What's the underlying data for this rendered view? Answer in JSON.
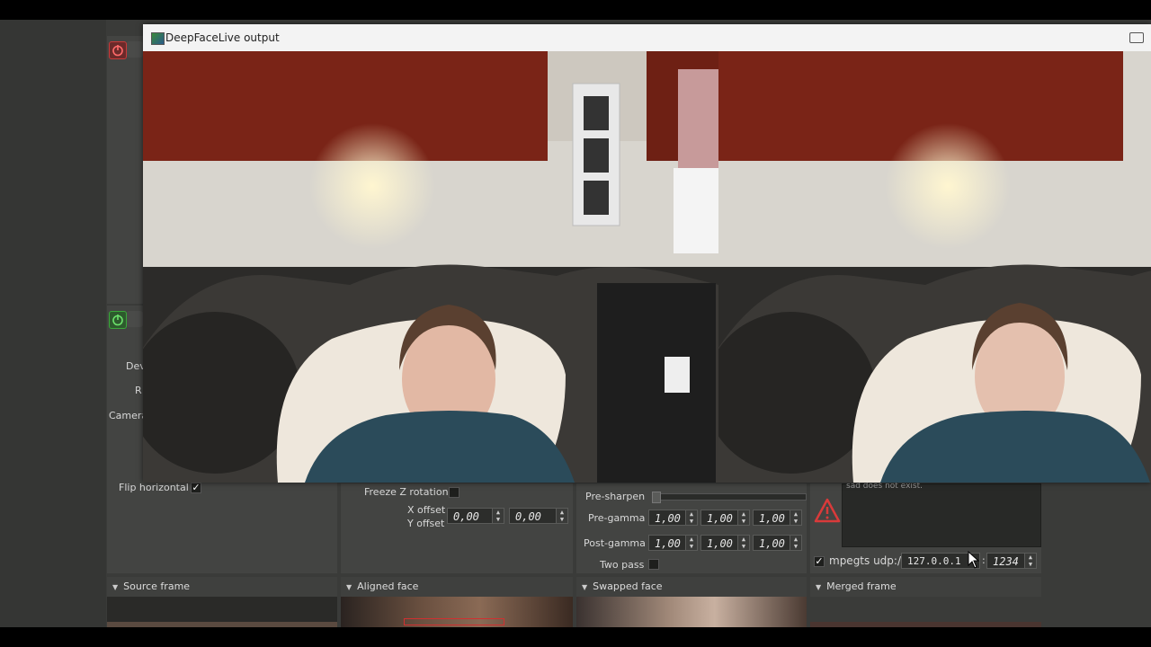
{
  "window": {
    "title": "DeepFaceLive output",
    "icon": "deepfacelive-app-icon",
    "control_icon": "window-restore-icon"
  },
  "source_panel": {
    "flip_horizontal_label": "Flip horizontal",
    "flip_horizontal_checked": true,
    "partial_labels": [
      "Dev",
      "R",
      "Camera"
    ]
  },
  "face_aligner": {
    "freeze_z_rotation_label": "Freeze Z rotation",
    "x_offset_label": "X offset",
    "y_offset_label": "Y offset",
    "x_offset_value": "0,00",
    "y_offset_value": "0,00"
  },
  "face_swapper": {
    "pre_sharpen_label": "Pre-sharpen",
    "pre_gamma_label": "Pre-gamma",
    "pre_gamma_values": [
      "1,00",
      "1,00",
      "1,00"
    ],
    "post_gamma_label": "Post-gamma",
    "post_gamma_values": [
      "1,00",
      "1,00",
      "1,00"
    ],
    "two_pass_label": "Two pass"
  },
  "stream_output": {
    "error_text": "sad does not exist.",
    "mpegts_label": "mpegts udp://",
    "mpegts_checked": true,
    "address_value": "127.0.0.1",
    "port_separator": ":",
    "port_value": "1234"
  },
  "previews": {
    "source_frame": "Source frame",
    "aligned_face": "Aligned face",
    "swapped_face": "Swapped face",
    "merged_frame": "Merged frame"
  },
  "colors": {
    "app_bg": "#3a3b39",
    "panel_bg": "#434442",
    "power_off": "#c83a3a",
    "power_on": "#3aa83a",
    "warning": "#d93a3a"
  }
}
